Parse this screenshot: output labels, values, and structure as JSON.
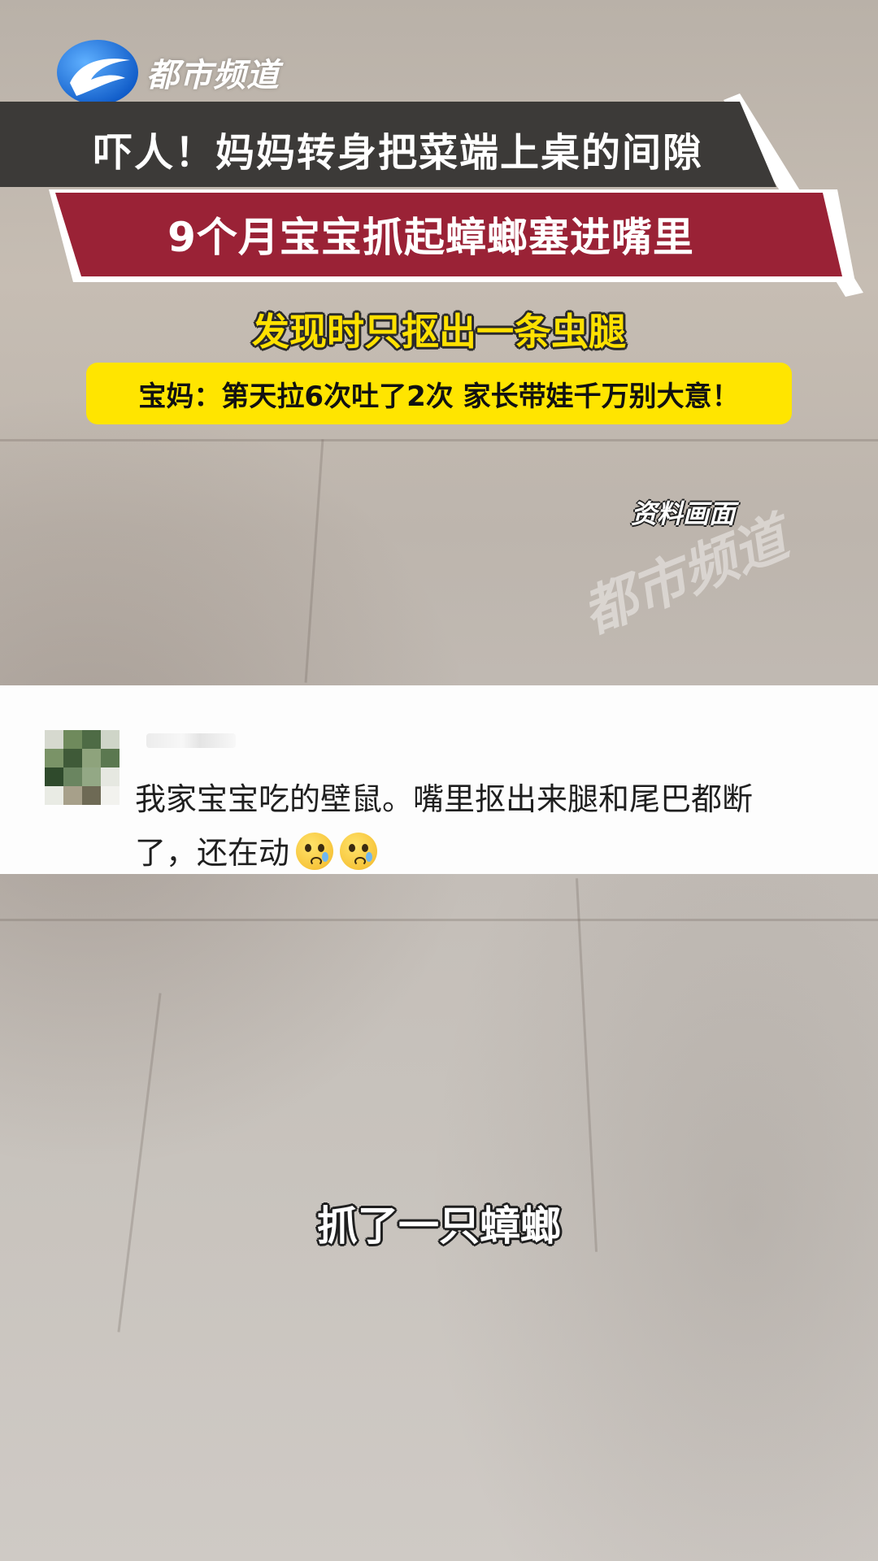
{
  "channel": {
    "logo_text": "都市频道",
    "brand_color": "#1f73d9"
  },
  "headline": {
    "line1": "吓人！妈妈转身把菜端上桌的间隙",
    "line2": "9个月宝宝抓起蟑螂塞进嘴里",
    "line3": "发现时只抠出一条虫腿",
    "line4": "宝妈：第天拉6次吐了2次  家长带娃千万别大意！",
    "colors": {
      "dark_band": "#3c3a38",
      "red_band": "#9a2236",
      "yellow": "#ffe500"
    }
  },
  "label_archive": "资料画面",
  "watermark": "都市频道",
  "comment": {
    "text_line1": "我家宝宝吃的壁鼠。嘴里抠出来腿和尾巴都断",
    "text_line2": "了，还在动",
    "emojis": [
      "crying-face-emoji",
      "crying-face-emoji"
    ]
  },
  "subtitle": "抓了一只蟑螂"
}
